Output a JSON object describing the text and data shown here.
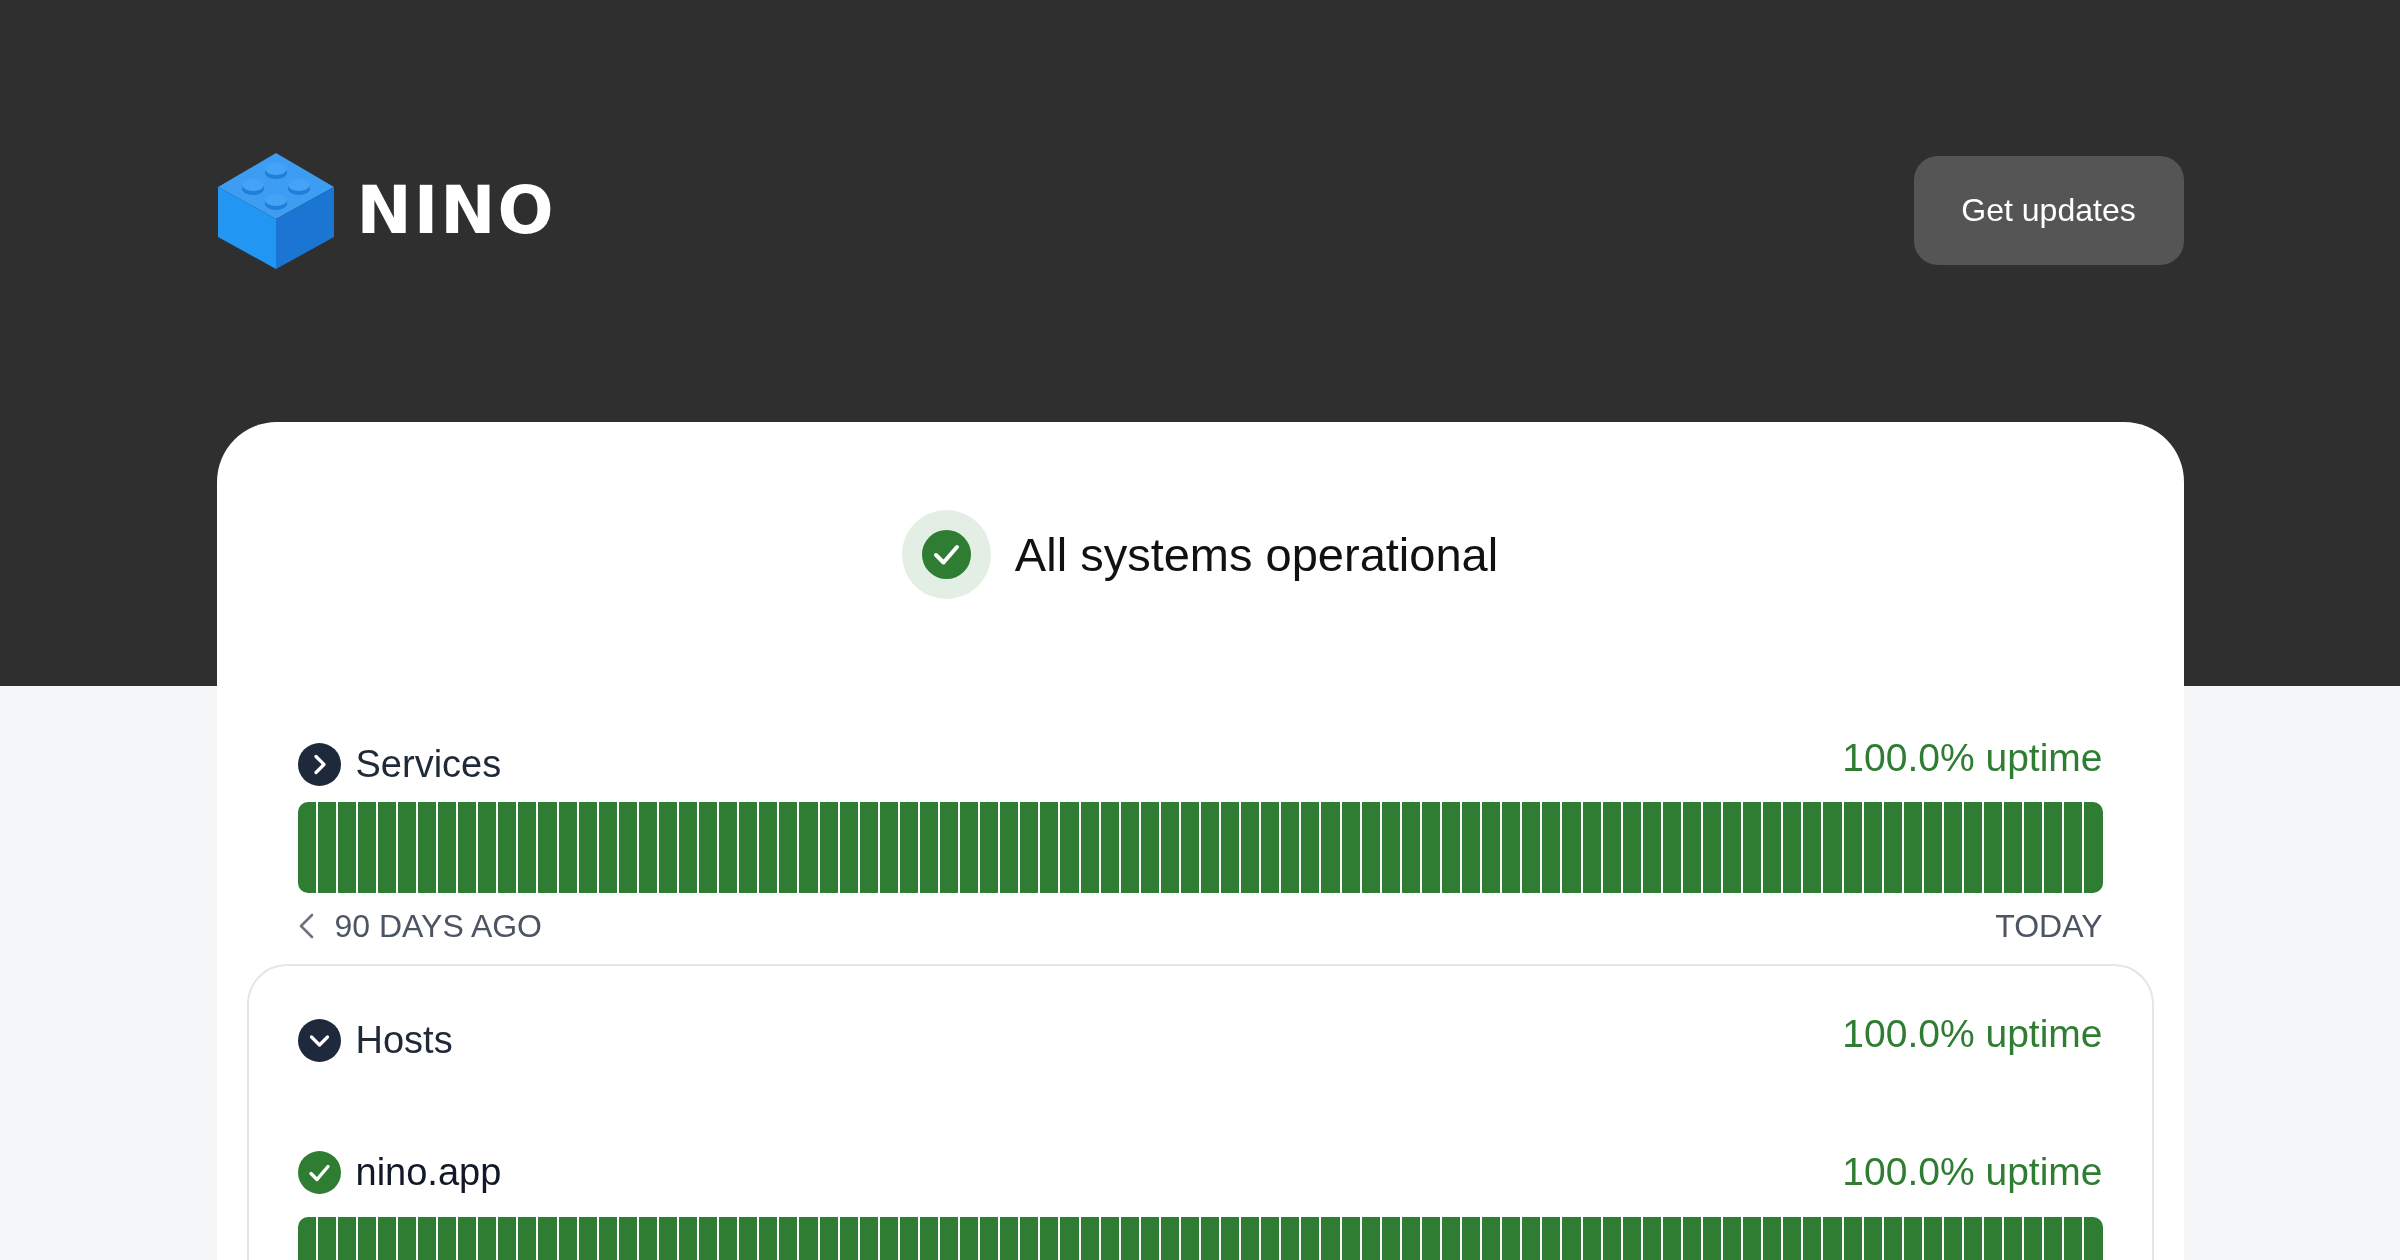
{
  "header": {
    "logo_text": "NINO",
    "button": "Get updates"
  },
  "status": {
    "operational": true,
    "text": "All systems operational"
  },
  "groups": [
    {
      "name": "Services",
      "expanded": false,
      "uptime": "100.0% uptime",
      "days": [
        {
          "up": true
        },
        {
          "up": true
        },
        {
          "up": true
        },
        {
          "up": true
        },
        {
          "up": true
        },
        {
          "up": true
        },
        {
          "up": true
        },
        {
          "up": true
        },
        {
          "up": true
        },
        {
          "up": true
        },
        {
          "up": true
        },
        {
          "up": true
        },
        {
          "up": true
        },
        {
          "up": true
        },
        {
          "up": true
        },
        {
          "up": true
        },
        {
          "up": true
        },
        {
          "up": true
        },
        {
          "up": true
        },
        {
          "up": true
        },
        {
          "up": true
        },
        {
          "up": true
        },
        {
          "up": true
        },
        {
          "up": true
        },
        {
          "up": true
        },
        {
          "up": true
        },
        {
          "up": true
        },
        {
          "up": true
        },
        {
          "up": true
        },
        {
          "up": true
        },
        {
          "up": true
        },
        {
          "up": true
        },
        {
          "up": true
        },
        {
          "up": true
        },
        {
          "up": true
        },
        {
          "up": true
        },
        {
          "up": true
        },
        {
          "up": true
        },
        {
          "up": true
        },
        {
          "up": true
        },
        {
          "up": true
        },
        {
          "up": true
        },
        {
          "up": true
        },
        {
          "up": true
        },
        {
          "up": true
        },
        {
          "up": true
        },
        {
          "up": true
        },
        {
          "up": true
        },
        {
          "up": true
        },
        {
          "up": true
        },
        {
          "up": true
        },
        {
          "up": true
        },
        {
          "up": true
        },
        {
          "up": true
        },
        {
          "up": true
        },
        {
          "up": true
        },
        {
          "up": true
        },
        {
          "up": true
        },
        {
          "up": true
        },
        {
          "up": true
        },
        {
          "up": true
        },
        {
          "up": true
        },
        {
          "up": true
        },
        {
          "up": true
        },
        {
          "up": true
        },
        {
          "up": true
        },
        {
          "up": true
        },
        {
          "up": true
        },
        {
          "up": true
        },
        {
          "up": true
        },
        {
          "up": true
        },
        {
          "up": true
        },
        {
          "up": true
        },
        {
          "up": true
        },
        {
          "up": true
        },
        {
          "up": true
        },
        {
          "up": true
        },
        {
          "up": true
        },
        {
          "up": true
        },
        {
          "up": true
        },
        {
          "up": true
        },
        {
          "up": true
        },
        {
          "up": true
        },
        {
          "up": true
        },
        {
          "up": true
        },
        {
          "up": true
        },
        {
          "up": true
        },
        {
          "up": true
        },
        {
          "up": true
        },
        {
          "up": true
        }
      ],
      "range_start": "90 DAYS AGO",
      "range_end": "TODAY"
    },
    {
      "name": "Hosts",
      "expanded": true,
      "uptime": "100.0% uptime",
      "children": [
        {
          "name": "nino.app",
          "up": true,
          "uptime": "100.0% uptime",
          "days": [
            {
              "up": true
            },
            {
              "up": true
            },
            {
              "up": true
            },
            {
              "up": true
            },
            {
              "up": true
            },
            {
              "up": true
            },
            {
              "up": true
            },
            {
              "up": true
            },
            {
              "up": true
            },
            {
              "up": true
            },
            {
              "up": true
            },
            {
              "up": true
            },
            {
              "up": true
            },
            {
              "up": true
            },
            {
              "up": true
            },
            {
              "up": true
            },
            {
              "up": true
            },
            {
              "up": true
            },
            {
              "up": true
            },
            {
              "up": true
            },
            {
              "up": true
            },
            {
              "up": true
            },
            {
              "up": true
            },
            {
              "up": true
            },
            {
              "up": true
            },
            {
              "up": true
            },
            {
              "up": true
            },
            {
              "up": true
            },
            {
              "up": true
            },
            {
              "up": true
            },
            {
              "up": true
            },
            {
              "up": true
            },
            {
              "up": true
            },
            {
              "up": true
            },
            {
              "up": true
            },
            {
              "up": true
            },
            {
              "up": true
            },
            {
              "up": true
            },
            {
              "up": true
            },
            {
              "up": true
            },
            {
              "up": true
            },
            {
              "up": true
            },
            {
              "up": true
            },
            {
              "up": true
            },
            {
              "up": true
            },
            {
              "up": true
            },
            {
              "up": true
            },
            {
              "up": true
            },
            {
              "up": true
            },
            {
              "up": true
            },
            {
              "up": true
            },
            {
              "up": true
            },
            {
              "up": true
            },
            {
              "up": true
            },
            {
              "up": true
            },
            {
              "up": true
            },
            {
              "up": true
            },
            {
              "up": true
            },
            {
              "up": true
            },
            {
              "up": true
            },
            {
              "up": true
            },
            {
              "up": true
            },
            {
              "up": true
            },
            {
              "up": true
            },
            {
              "up": true
            },
            {
              "up": true
            },
            {
              "up": true
            },
            {
              "up": true
            },
            {
              "up": true
            },
            {
              "up": true
            },
            {
              "up": true
            },
            {
              "up": true
            },
            {
              "up": true
            },
            {
              "up": true
            },
            {
              "up": true
            },
            {
              "up": true
            },
            {
              "up": true
            },
            {
              "up": true
            },
            {
              "up": true
            },
            {
              "up": true
            },
            {
              "up": true
            },
            {
              "up": true
            },
            {
              "up": true
            },
            {
              "up": true
            },
            {
              "up": true
            },
            {
              "up": true
            },
            {
              "up": true
            },
            {
              "up": true
            },
            {
              "up": true
            },
            {
              "up": true
            }
          ]
        }
      ]
    }
  ]
}
